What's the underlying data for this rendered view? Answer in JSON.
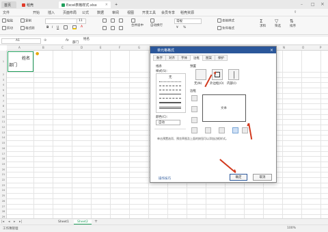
{
  "titlebar": {
    "home_tab": "首页",
    "wps_tab": "稻壳",
    "doc_tab": "Excel表格样式.xlsx",
    "new_tab": "+"
  },
  "menu": [
    "文件",
    "开始",
    "插入",
    "页面布局",
    "公式",
    "数据",
    "审阅",
    "视图",
    "开发工具",
    "会员专享",
    "稻壳资源"
  ],
  "toolbar": {
    "paste": "粘贴",
    "cut": "剪切",
    "copy": "复制",
    "format_painter": "格式刷",
    "font_size": "11",
    "bold": "B",
    "merge": "合并居中",
    "wrap": "自动换行",
    "general": "常规",
    "table_style": "表格样式",
    "cond_format": "条件格式",
    "sum": "求和",
    "filter": "筛选",
    "sort": "排序"
  },
  "formula": {
    "cell_ref": "A1",
    "fx": "fx",
    "content_line1": "姓名",
    "content_line2": "部门"
  },
  "sheet": {
    "columns": [
      "A",
      "B",
      "C",
      "D",
      "E",
      "F",
      "G",
      "H",
      "I",
      "J",
      "K",
      "L",
      "M",
      "N",
      "O",
      "P"
    ],
    "rows": [
      "1",
      "2",
      "3",
      "4",
      "5",
      "6",
      "7",
      "8",
      "9",
      "10",
      "11",
      "12",
      "13",
      "14",
      "15",
      "16",
      "17",
      "18",
      "19",
      "20",
      "21",
      "22",
      "23",
      "24",
      "25",
      "26",
      "27",
      "28",
      "29",
      "30"
    ],
    "cell_a1_top": "姓名",
    "cell_a1_bottom": "部门"
  },
  "dialog": {
    "title": "单元格格式",
    "tabs": [
      "数字",
      "对齐",
      "字体",
      "边框",
      "图案",
      "保护"
    ],
    "active_tab": "边框",
    "line_label": "线条",
    "style_label": "样式(S):",
    "none_label": "无",
    "color_label": "颜色(C):",
    "color_value": "自动",
    "preset_label": "预置",
    "preset_none": "无(N)",
    "preset_outline": "外边框(O)",
    "preset_inside": "内部(I)",
    "border_label": "边框",
    "preview_text": "文本",
    "hint": "单击预置选项、预览草图及上面的按钮可以添加边框样式。",
    "tips_link": "操作技巧",
    "ok": "确定",
    "cancel": "取消"
  },
  "sheettabs": [
    "Sheet1",
    "Sheet2"
  ],
  "status": {
    "left": "工作簿管理",
    "zoom": "100%"
  },
  "colors": {
    "accent_green": "#1f9e5b",
    "dialog_title": "#2b579a",
    "arrow_red": "#d23a1e",
    "ok_border": "#2b579a"
  }
}
